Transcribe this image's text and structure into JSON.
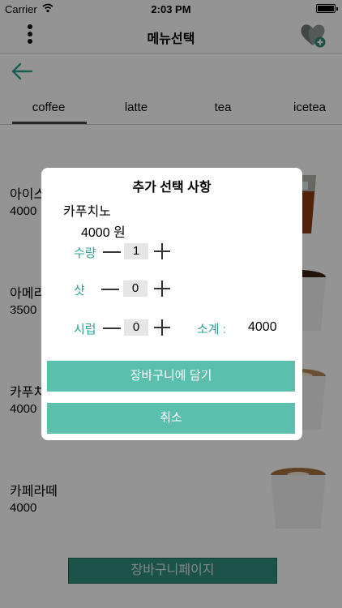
{
  "status_bar": {
    "carrier": "Carrier",
    "time": "2:03 PM"
  },
  "nav": {
    "title": "메뉴선택"
  },
  "tabs": [
    {
      "label": "coffee",
      "active": true
    },
    {
      "label": "latte"
    },
    {
      "label": "tea"
    },
    {
      "label": "icetea"
    }
  ],
  "menu_items": [
    {
      "name": "아이스",
      "price": "4000"
    },
    {
      "name": "아메리",
      "price": "3500"
    },
    {
      "name": "카푸치",
      "price": "4000"
    },
    {
      "name": "카페라떼",
      "price": "4000"
    }
  ],
  "cart_page_button": "장바구니페이지",
  "modal": {
    "title": "추가 선택 사항",
    "product_name": "카푸치노",
    "price": "4000 원",
    "options": [
      {
        "label": "수량",
        "value": "1"
      },
      {
        "label": "샷",
        "value": "0"
      },
      {
        "label": "시럽",
        "value": "0"
      }
    ],
    "subtotal_label": "소계 :",
    "subtotal_value": "4000",
    "add_to_cart": "장바구니에 담기",
    "cancel": "취소"
  },
  "colors": {
    "accent": "#5bbfad",
    "accent_text": "#2aa394",
    "dark_button": "#2f8f7f"
  }
}
